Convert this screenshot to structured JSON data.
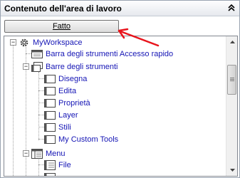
{
  "panel": {
    "title": "Contenuto dell'area di lavoro",
    "collapse_icon": "double-chevron-up-icon"
  },
  "toolbar": {
    "done_label": "Fatto"
  },
  "tree": {
    "items": [
      {
        "label": "MyWorkspace",
        "icon": "gear-icon",
        "expander": "minus"
      },
      {
        "label": "Barra degli strumenti Accesso rapido",
        "icon": "toolbar-icon",
        "expander": "none"
      },
      {
        "label": "Barre degli strumenti",
        "icon": "toolbars-icon",
        "expander": "minus"
      },
      {
        "label": "Disegna",
        "icon": "toolbar-icon",
        "expander": "none"
      },
      {
        "label": "Edita",
        "icon": "toolbar-icon",
        "expander": "none"
      },
      {
        "label": "Proprietà",
        "icon": "toolbar-icon",
        "expander": "none"
      },
      {
        "label": "Layer",
        "icon": "toolbar-icon",
        "expander": "none"
      },
      {
        "label": "Stili",
        "icon": "toolbar-icon",
        "expander": "none"
      },
      {
        "label": "My Custom Tools",
        "icon": "toolbar-icon",
        "expander": "none"
      },
      {
        "label": "Menu",
        "icon": "menu-icon",
        "expander": "minus"
      },
      {
        "label": "File",
        "icon": "menu-item-icon",
        "expander": "none"
      }
    ]
  },
  "annotation": {
    "color": "#e8141c"
  }
}
